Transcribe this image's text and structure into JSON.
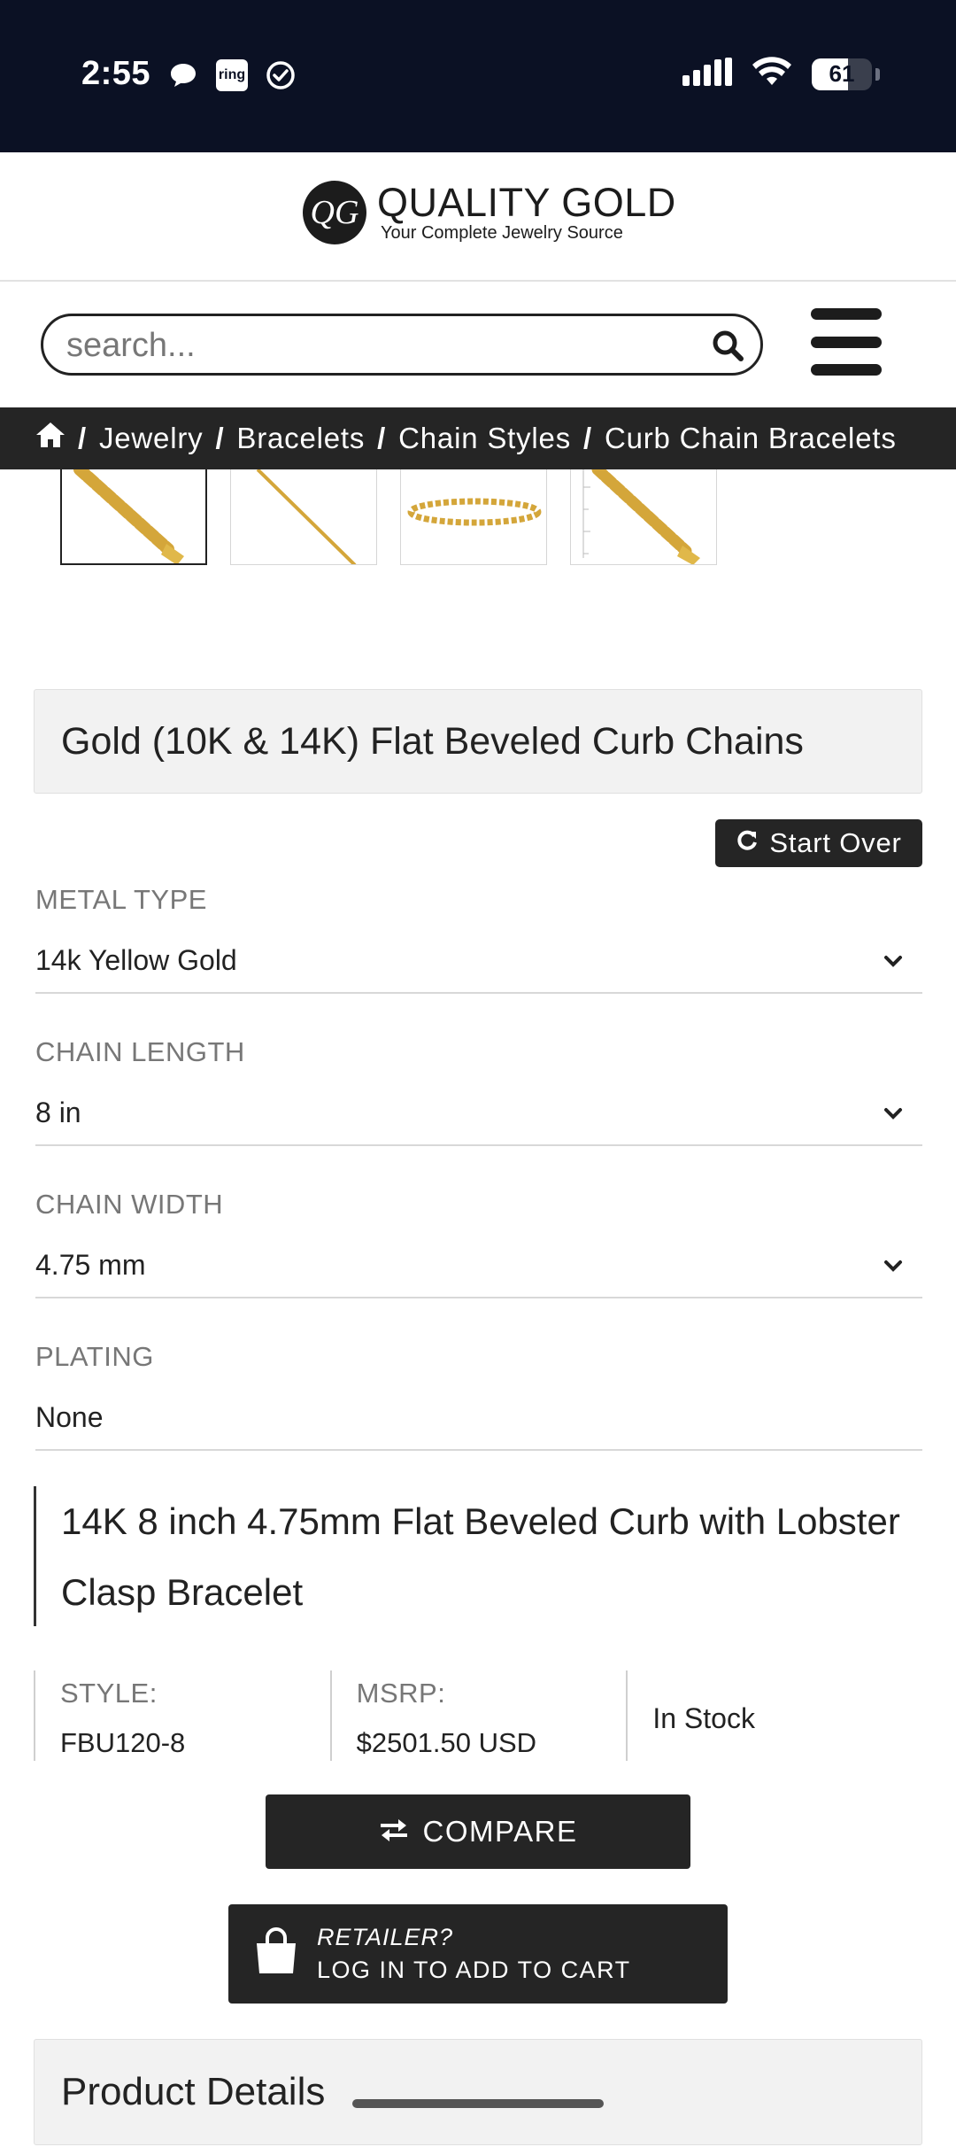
{
  "status_bar": {
    "time": "2:55",
    "ring_app_label": "ring",
    "battery_level": "61"
  },
  "header": {
    "logo_monogram": "QG",
    "logo_title": "QUALITY GOLD",
    "logo_tagline": "Your Complete Jewelry Source"
  },
  "search": {
    "placeholder": "search..."
  },
  "breadcrumb": {
    "items": [
      "Jewelry",
      "Bracelets",
      "Chain Styles",
      "Curb Chain Bracelets"
    ],
    "separator": "/"
  },
  "gallery": {
    "thumbnails": [
      "chain-closeup",
      "chain-straight",
      "bracelet-full",
      "chain-with-ruler"
    ],
    "selected_index": 0
  },
  "product_family": {
    "title": "Gold (10K & 14K) Flat Beveled Curb Chains",
    "start_over_label": "Start Over"
  },
  "options": [
    {
      "label": "METAL TYPE",
      "value": "14k Yellow Gold",
      "has_dropdown": true
    },
    {
      "label": "CHAIN LENGTH",
      "value": "8 in",
      "has_dropdown": true
    },
    {
      "label": "CHAIN WIDTH",
      "value": "4.75 mm",
      "has_dropdown": true
    },
    {
      "label": "PLATING",
      "value": "None",
      "has_dropdown": false
    }
  ],
  "product": {
    "name": "14K 8 inch 4.75mm Flat Beveled Curb with Lobster Clasp Bracelet",
    "style_label": "STYLE:",
    "style_value": "FBU120-8",
    "msrp_label": "MSRP:",
    "msrp_value": "$2501.50 USD",
    "stock_status": "In Stock"
  },
  "actions": {
    "compare_label": "COMPARE",
    "retailer_label": "RETAILER?",
    "login_label": "LOG IN TO ADD TO CART"
  },
  "details": {
    "title": "Product Details"
  },
  "colors": {
    "status_bar_bg": "#0b1124",
    "dark_bar": "#252525",
    "panel_bg": "#f2f2f2",
    "gold": "#d4a63a"
  }
}
